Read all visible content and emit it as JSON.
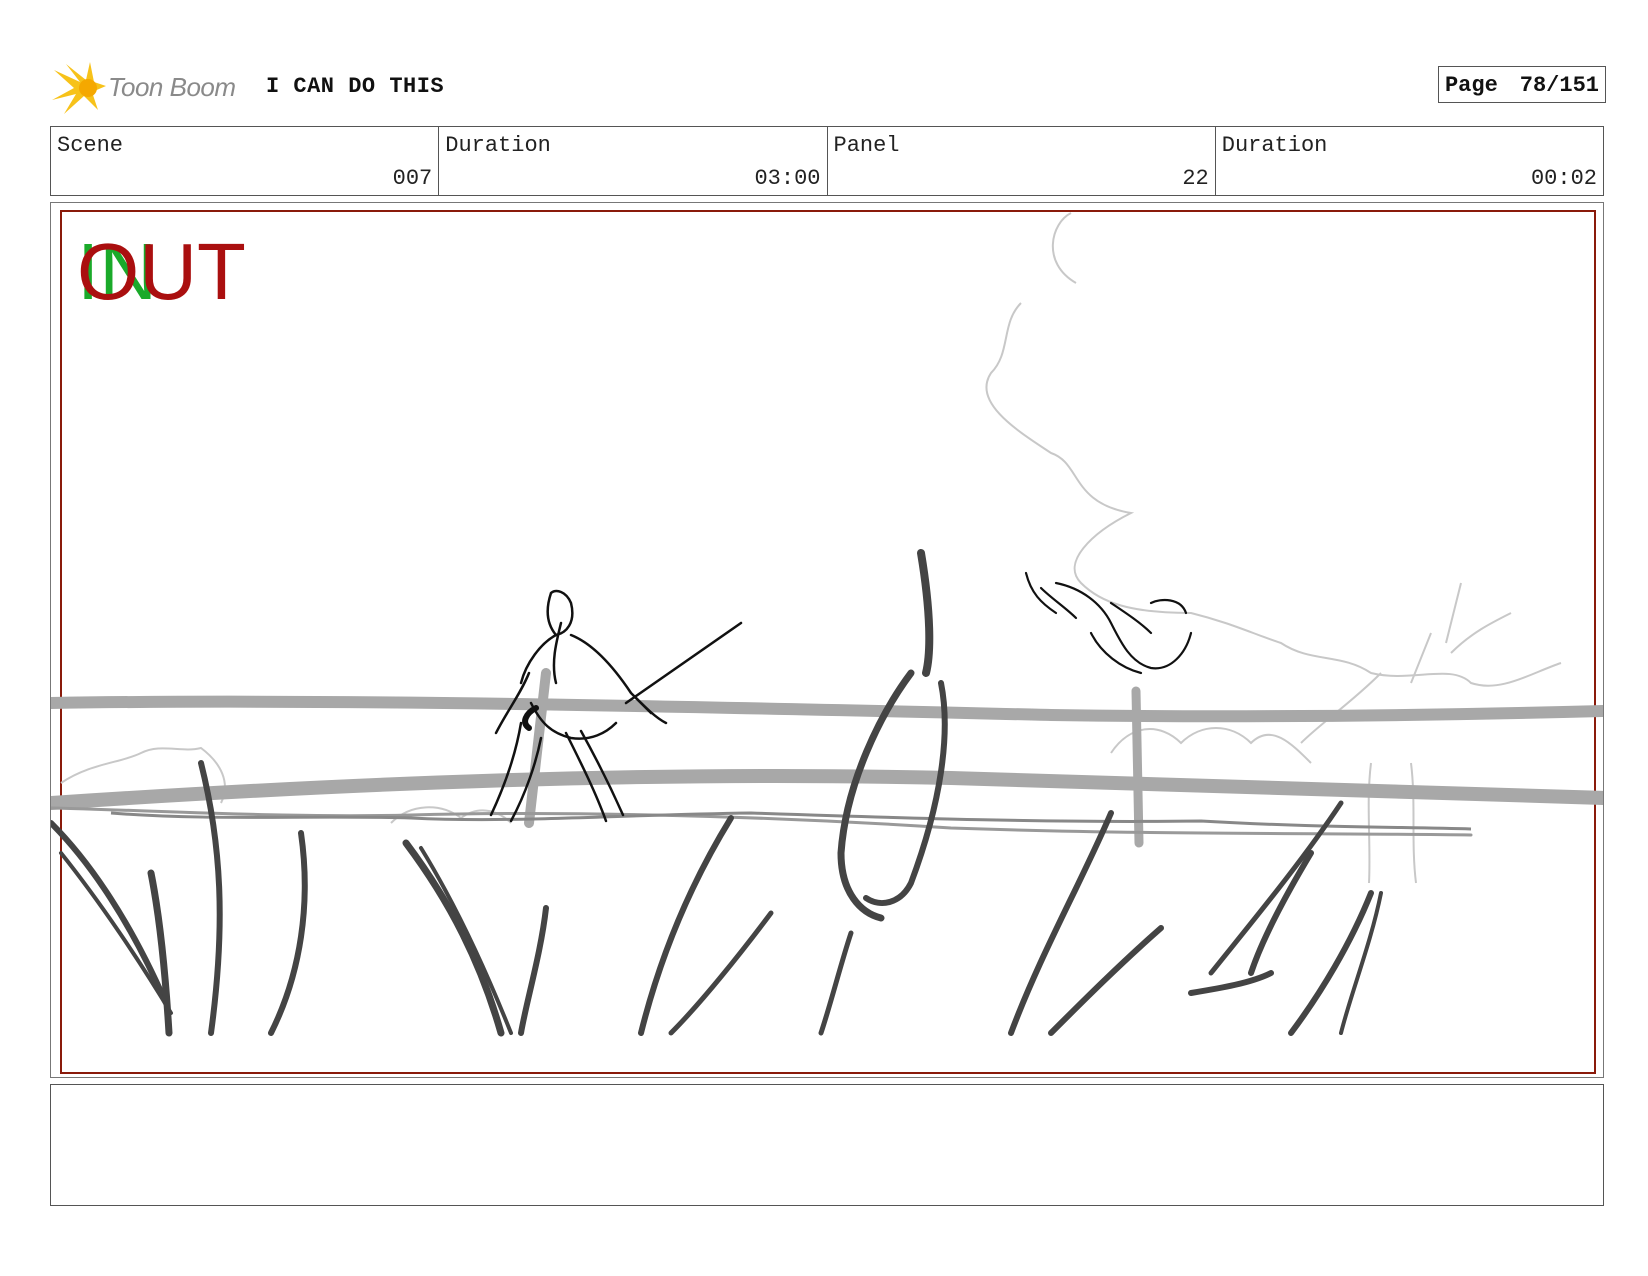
{
  "header": {
    "logo_text": "Toon Boom",
    "project_title": "I CAN DO THIS",
    "page_label": "Page",
    "page_value": "78/151"
  },
  "info": {
    "scene_label": "Scene",
    "scene_value": "007",
    "scene_duration_label": "Duration",
    "scene_duration_value": "03:00",
    "panel_label": "Panel",
    "panel_value": "22",
    "panel_duration_label": "Duration",
    "panel_duration_value": "00:02"
  },
  "panel": {
    "in_marker": "IN",
    "out_marker": "OUT",
    "in_color": "#1aaa2a",
    "out_color": "#aa0f0f",
    "frame_color": "#8a1a0a"
  },
  "notes": {
    "text": ""
  }
}
